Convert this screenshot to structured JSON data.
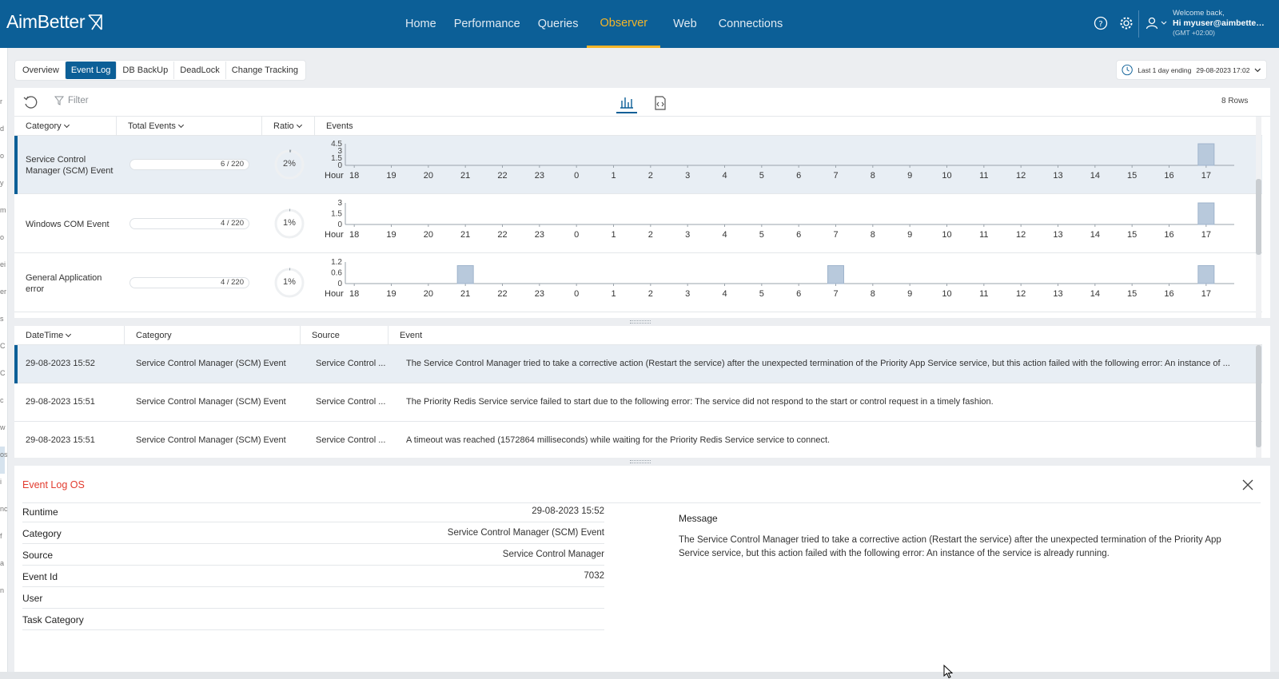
{
  "app": {
    "logo_text": "AimBetter",
    "brand_color": "#0c5f97",
    "accent_color": "#f5b528"
  },
  "nav": {
    "items": [
      {
        "label": "Home",
        "active": false
      },
      {
        "label": "Performance",
        "active": false
      },
      {
        "label": "Queries",
        "active": false
      },
      {
        "label": "Observer",
        "active": true
      },
      {
        "label": "Web",
        "active": false
      },
      {
        "label": "Connections",
        "active": false
      }
    ]
  },
  "header": {
    "icons": [
      "help-icon",
      "gear-icon",
      "user-icon"
    ],
    "welcome": "Welcome back,",
    "user": "Hi myuser@aimbetter....",
    "tz": "(GMT +02:00)"
  },
  "subtabs": {
    "items": [
      {
        "label": "Overview",
        "active": false
      },
      {
        "label": "Event Log",
        "active": true
      },
      {
        "label": "DB BackUp",
        "active": false
      },
      {
        "label": "DeadLock",
        "active": false
      },
      {
        "label": "Change Tracking",
        "active": false
      }
    ]
  },
  "timerange": {
    "label": "Last 1 day ending",
    "value": "29-08-2023 17:02"
  },
  "toolbar": {
    "filter_label": "Filter",
    "rows_label": "8 Rows",
    "view_icons": [
      "bar-chart-icon",
      "code-file-icon"
    ]
  },
  "categories_table": {
    "headers": {
      "category": "Category",
      "total": "Total Events",
      "ratio": "Ratio",
      "events": "Events"
    },
    "hour_label": "Hour",
    "hours": [
      "18",
      "19",
      "20",
      "21",
      "22",
      "23",
      "0",
      "1",
      "2",
      "3",
      "4",
      "5",
      "6",
      "7",
      "8",
      "9",
      "10",
      "11",
      "12",
      "13",
      "14",
      "15",
      "16",
      "17"
    ],
    "rows": [
      {
        "label": "Service Control Manager (SCM) Event",
        "total": "6 / 220",
        "total_fraction": 0.027,
        "ratio": "2%",
        "ratio_value": 0.02,
        "y_ticks": [
          "4.5",
          "3",
          "1.5",
          "0"
        ],
        "y_max": 4.5,
        "counts": [
          0,
          0,
          0,
          0,
          0,
          0,
          0,
          0,
          0,
          0,
          0,
          0,
          0,
          0,
          0,
          0,
          0,
          0,
          0,
          0,
          0,
          0,
          0,
          6
        ],
        "selected": true
      },
      {
        "label": "Windows COM Event",
        "total": "4 / 220",
        "total_fraction": 0.018,
        "ratio": "1%",
        "ratio_value": 0.01,
        "y_ticks": [
          "3",
          "1.5",
          "0"
        ],
        "y_max": 3,
        "counts": [
          0,
          0,
          0,
          0,
          0,
          0,
          0,
          0,
          0,
          0,
          0,
          0,
          0,
          0,
          0,
          0,
          0,
          0,
          0,
          0,
          0,
          0,
          0,
          4
        ],
        "selected": false
      },
      {
        "label": "General Application error",
        "total": "4 / 220",
        "total_fraction": 0.018,
        "ratio": "1%",
        "ratio_value": 0.01,
        "y_ticks": [
          "1.2",
          "0.6",
          "0"
        ],
        "y_max": 1.2,
        "counts": [
          0,
          0,
          0,
          1,
          0,
          0,
          0,
          0,
          0,
          0,
          0,
          0,
          0,
          1,
          0,
          0,
          0,
          0,
          0,
          0,
          0,
          0,
          0,
          1
        ],
        "selected": false
      }
    ]
  },
  "events_table": {
    "headers": {
      "datetime": "DateTime",
      "category": "Category",
      "source": "Source",
      "event": "Event"
    },
    "rows": [
      {
        "datetime": "29-08-2023 15:52",
        "category": "Service Control Manager (SCM) Event",
        "source": "Service Control ...",
        "event": "The Service Control Manager tried to take a corrective action (Restart the service) after the unexpected termination of the Priority App Service service, but this action failed with the following error: An instance of ...",
        "selected": true
      },
      {
        "datetime": "29-08-2023 15:51",
        "category": "Service Control Manager (SCM) Event",
        "source": "Service Control ...",
        "event": "The Priority Redis Service service failed to start due to the following error: The service did not respond to the start or control request in a timely fashion.",
        "selected": false
      },
      {
        "datetime": "29-08-2023 15:51",
        "category": "Service Control Manager (SCM) Event",
        "source": "Service Control ...",
        "event": "A timeout was reached (1572864 milliseconds) while waiting for the Priority Redis Service service to connect.",
        "selected": false
      }
    ]
  },
  "detail": {
    "title": "Event Log OS",
    "fields": [
      {
        "key": "Runtime",
        "value": "29-08-2023 15:52"
      },
      {
        "key": "Category",
        "value": "Service Control Manager (SCM) Event"
      },
      {
        "key": "Source",
        "value": "Service Control Manager"
      },
      {
        "key": "Event Id",
        "value": "7032"
      },
      {
        "key": "User",
        "value": ""
      },
      {
        "key": "Task Category",
        "value": ""
      }
    ],
    "message_label": "Message",
    "message": "The Service Control Manager tried to take a corrective action (Restart the service) after the unexpected termination of the Priority App Service service, but this action failed with the following error: An instance of the service is already running."
  },
  "left_gutter_letters": [
    "r",
    "d",
    "o",
    "y",
    "m",
    "o",
    "ei",
    "er",
    "s",
    "C",
    "C",
    "c",
    "w",
    "os",
    "i",
    "nc",
    "f",
    "a",
    "n"
  ]
}
